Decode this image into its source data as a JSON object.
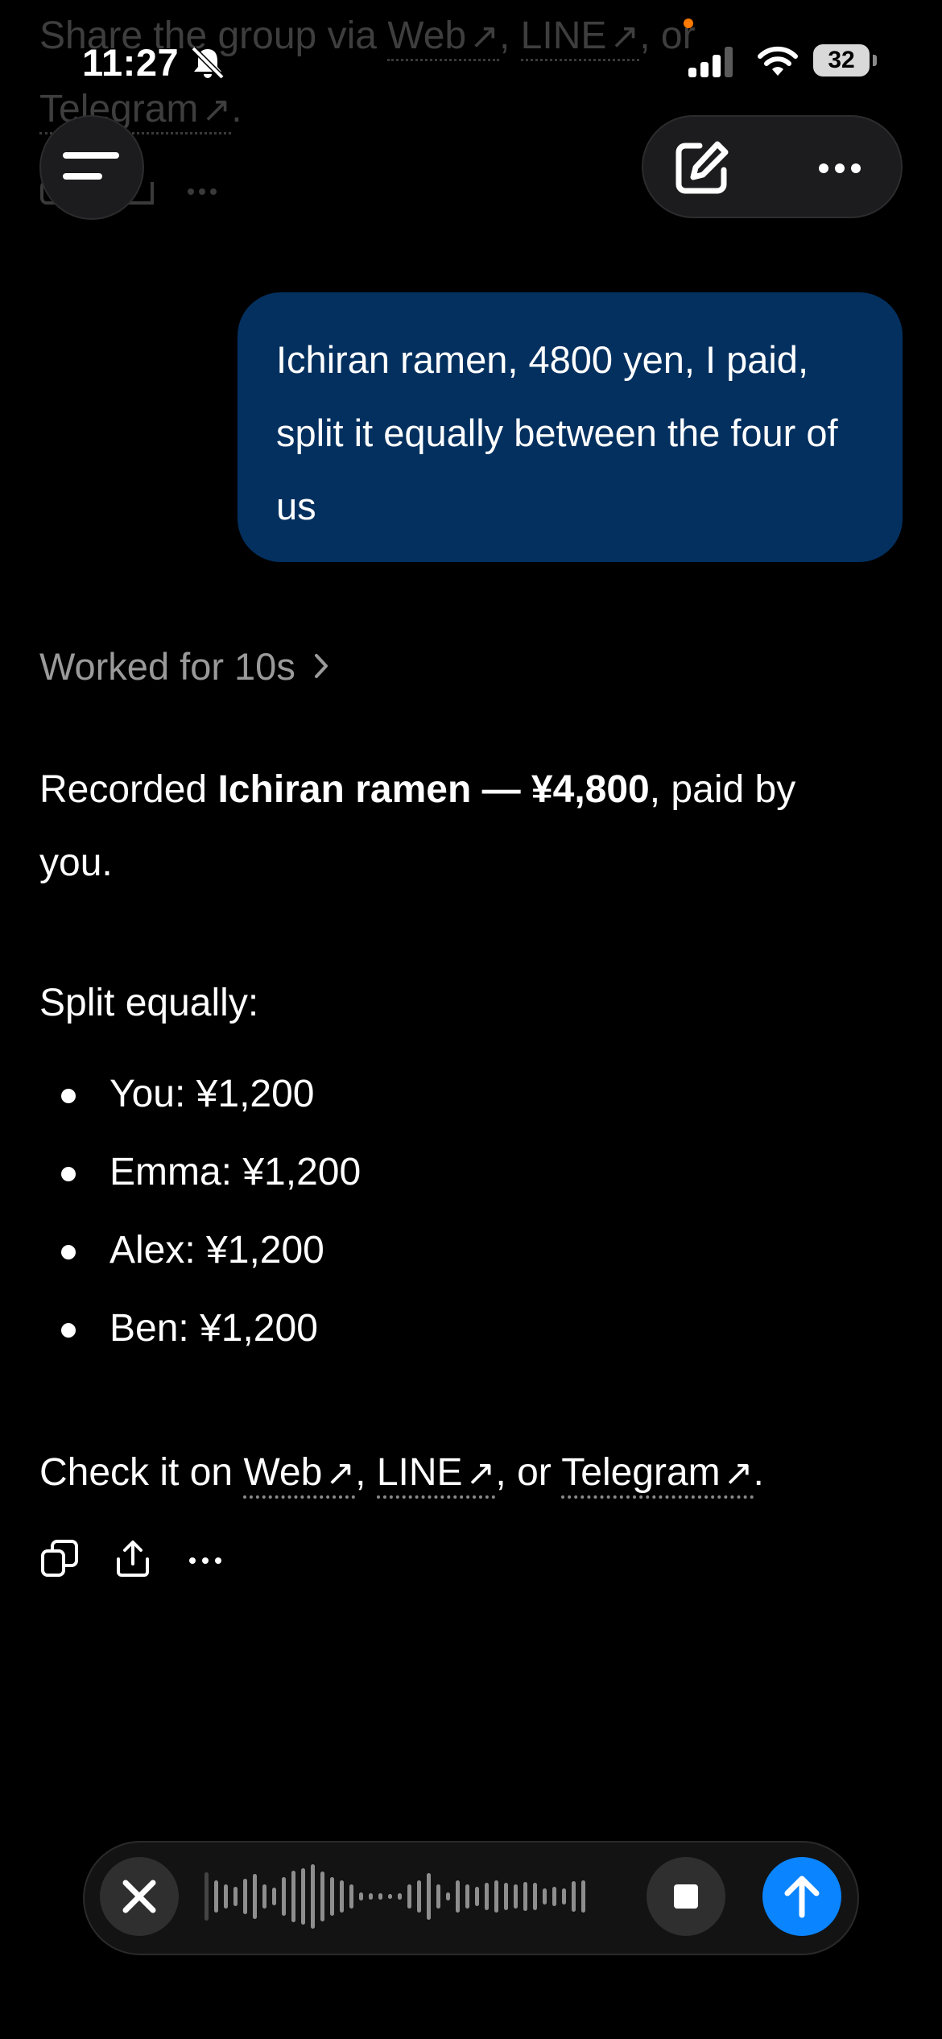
{
  "previous_message": {
    "line1_prefix": "Share the group via ",
    "link_web": "Web",
    "sep1": ", ",
    "link_line": "LINE",
    "sep2": ", or",
    "link_telegram": "Telegram",
    "end": "."
  },
  "status_bar": {
    "time": "11:27",
    "battery": "32"
  },
  "user_message": {
    "text": "Ichiran ramen, 4800 yen, I paid, split it equally between the four of us"
  },
  "worked": {
    "label": "Worked for 10s"
  },
  "assistant": {
    "p1_prefix": "Recorded ",
    "p1_bold": "Ichiran ramen — ¥4,800",
    "p1_suffix": ", paid by you.",
    "p2": "Split equally:",
    "bullets": [
      "You: ¥1,200",
      "Emma: ¥1,200",
      "Alex: ¥1,200",
      "Ben: ¥1,200"
    ],
    "p3_prefix": "Check it on ",
    "link_web": "Web",
    "sep1": ", ",
    "link_line": "LINE",
    "sep2": ", or ",
    "link_telegram": "Telegram",
    "p3_end": "."
  },
  "icons": {
    "arrow": "↗"
  },
  "colors": {
    "background": "#000000",
    "user_bubble": "#03305f",
    "send_button": "#0a84ff",
    "notification_dot": "#ff7a00"
  }
}
